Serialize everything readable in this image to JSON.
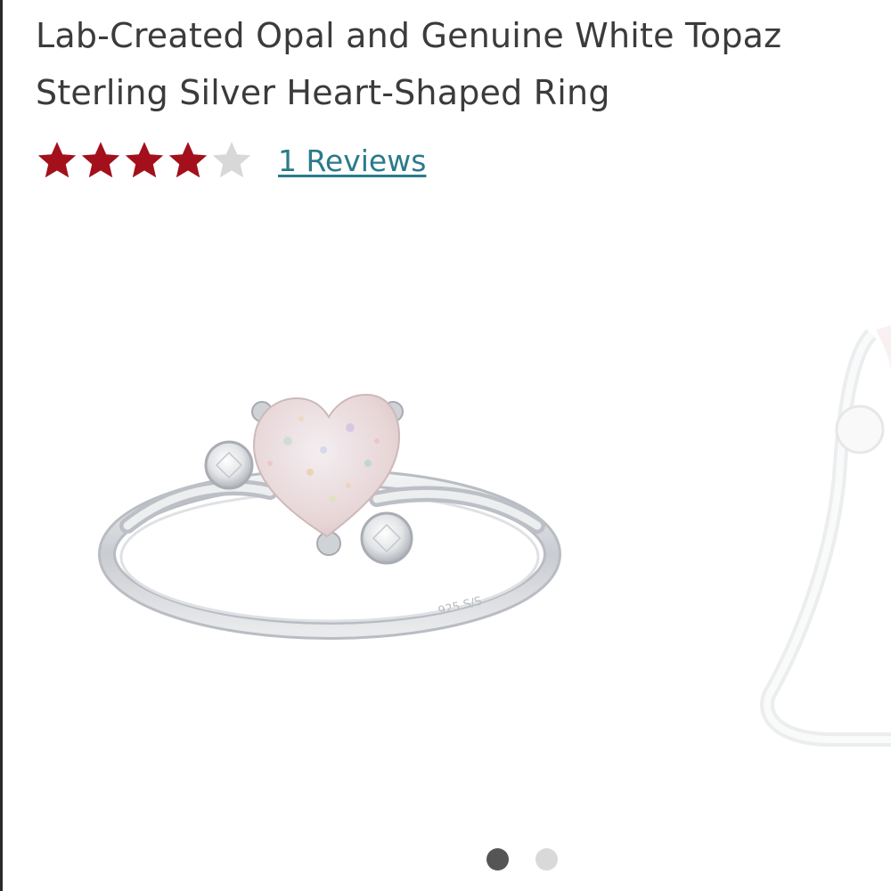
{
  "product": {
    "title": "Lab-Created Opal and Genuine White Topaz Sterling Silver Heart-Shaped Ring",
    "rating": 4,
    "rating_max": 5,
    "reviews_label": "1 Reviews"
  },
  "colors": {
    "star_filled": "#a3101c",
    "star_empty": "#d8d8d8",
    "link": "#2a7a8c",
    "dot_active": "#555555",
    "dot_inactive": "#d9d9d9"
  },
  "gallery": {
    "image_count": 2,
    "active_index": 0
  }
}
